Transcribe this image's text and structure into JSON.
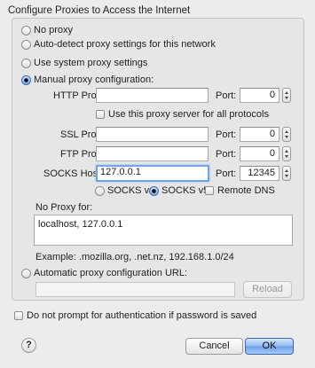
{
  "group_title": "Configure Proxies to Access the Internet",
  "radios": {
    "no_proxy": "No proxy",
    "auto_detect": "Auto-detect proxy settings for this network",
    "system": "Use system proxy settings",
    "manual": "Manual proxy configuration:",
    "auto_url": "Automatic proxy configuration URL:"
  },
  "http": {
    "label": "HTTP Proxy:",
    "host": "",
    "port_label": "Port:",
    "port": "0"
  },
  "same_proxy_label": "Use this proxy server for all protocols",
  "ssl": {
    "label": "SSL Proxy:",
    "host": "",
    "port_label": "Port:",
    "port": "0"
  },
  "ftp": {
    "label": "FTP Proxy:",
    "host": "",
    "port_label": "Port:",
    "port": "0"
  },
  "socks": {
    "label": "SOCKS Host:",
    "host": "127.0.0.1",
    "port_label": "Port:",
    "port": "12345"
  },
  "socks_options": {
    "v4": "SOCKS v4",
    "v5": "SOCKS v5",
    "remote_dns": "Remote DNS"
  },
  "no_proxy_for": {
    "label": "No Proxy for:",
    "value": "localhost, 127.0.0.1",
    "example": "Example: .mozilla.org, .net.nz, 192.168.1.0/24"
  },
  "auto_url": {
    "value": "",
    "reload_label": "Reload"
  },
  "no_prompt_label": "Do not prompt for authentication if password is saved",
  "footer": {
    "help": "?",
    "cancel_label": "Cancel",
    "ok_label": "OK"
  },
  "colors": {
    "accent": "#6fa1e8",
    "focus_ring": "#6ea6e8",
    "background": "#ececec"
  }
}
